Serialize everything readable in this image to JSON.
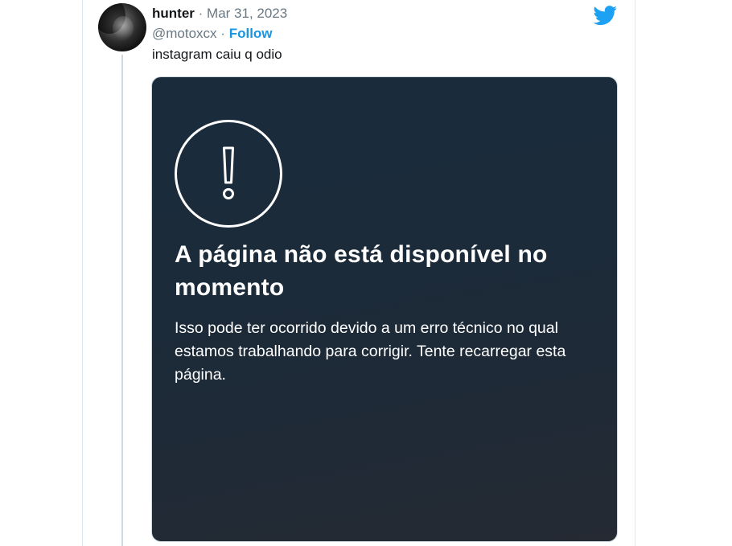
{
  "tweet": {
    "author_name": "hunter",
    "separator": "·",
    "date": "Mar 31, 2023",
    "handle": "@motoxcx",
    "follow_label": "Follow",
    "text": "instagram caiu q odio",
    "avatar_icon": "user-avatar",
    "brand_icon": "twitter-bird-icon",
    "brand_color": "#1da1f2",
    "follow_color": "#1b95e0"
  },
  "media": {
    "icon": "exclamation-circle-icon",
    "title": "A página não está disponível no momento",
    "body": "Isso pode ter ocorrido devido a um erro técnico no qual estamos trabalhando para corrigir. Tente recarregar esta página.",
    "background_color": "#1b2b3a",
    "text_color": "#ffffff"
  }
}
